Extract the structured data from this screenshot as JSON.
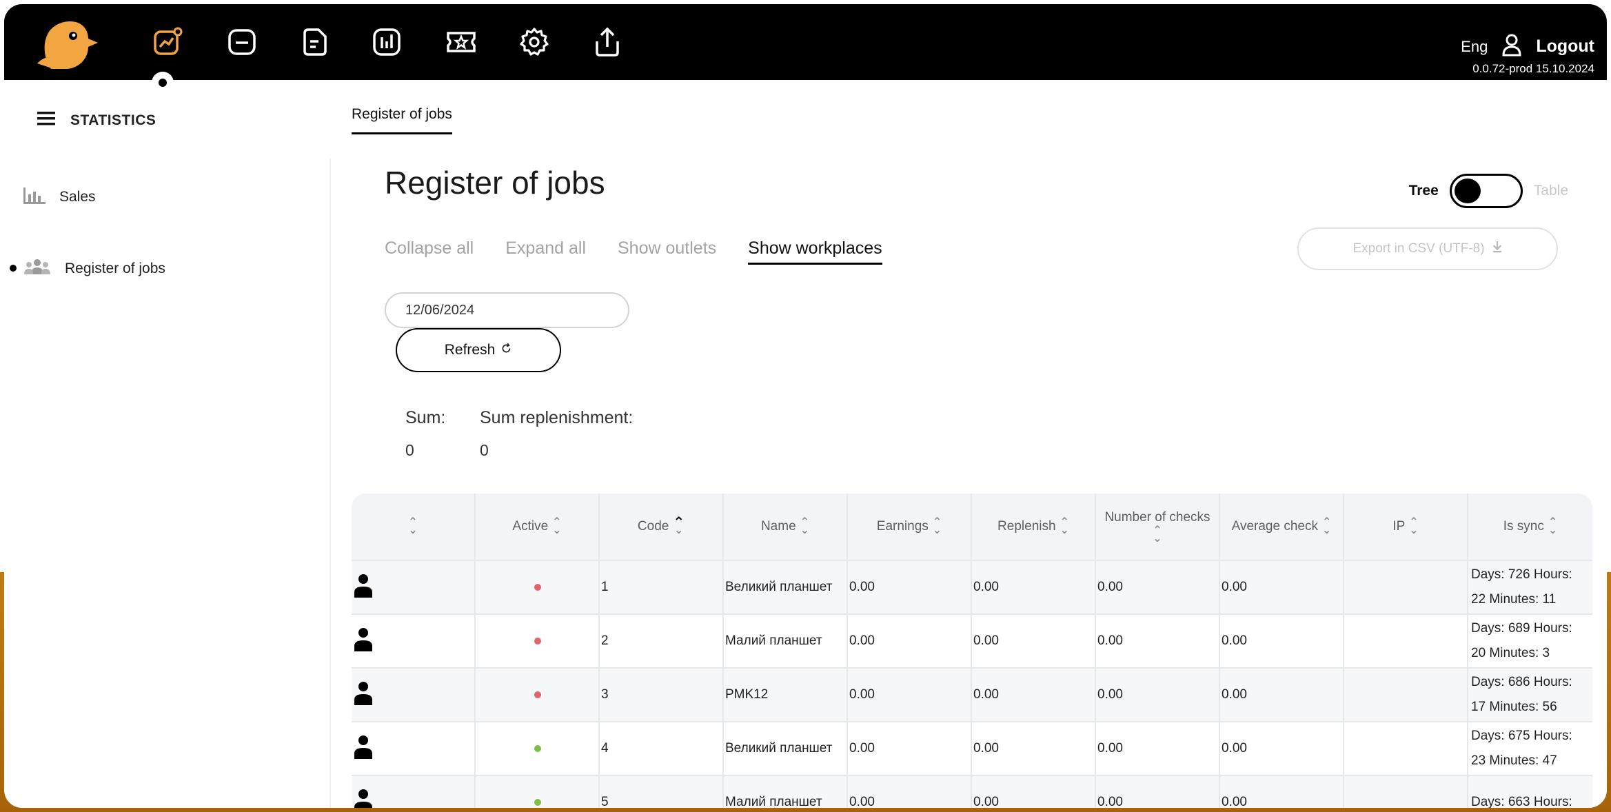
{
  "topbar": {
    "logo": "bird-logo",
    "nav_icons": [
      "statistics-icon",
      "folder-icon",
      "document-icon",
      "bar-chart-icon",
      "ticket-icon",
      "settings-icon",
      "upload-icon"
    ],
    "lang": "Eng",
    "logout": "Logout",
    "version": "0.0.72-prod 15.10.2024"
  },
  "sidebar": {
    "title": "STATISTICS",
    "items": [
      {
        "label": "Sales",
        "icon": "bar-chart-icon"
      },
      {
        "label": "Register of jobs",
        "icon": "people-icon",
        "active": true
      }
    ]
  },
  "breadcrumb": "Register of jobs",
  "page": {
    "title": "Register of jobs",
    "toggle": {
      "left": "Tree",
      "right": "Table",
      "state": "Tree"
    },
    "filters": [
      "Collapse all",
      "Expand all",
      "Show outlets",
      "Show workplaces"
    ],
    "export": "Export in CSV (UTF-8)",
    "date": "12/06/2024",
    "refresh": "Refresh",
    "sum_label": "Sum:",
    "sum_value": "0",
    "sum_repl_label": "Sum replenishment:",
    "sum_repl_value": "0"
  },
  "table": {
    "columns": [
      "",
      "Active",
      "Code",
      "Name",
      "Earnings",
      "Replenish",
      "Number of checks",
      "Average check",
      "IP",
      "Is sync"
    ],
    "rows": [
      {
        "active": "#e06666",
        "code": "1",
        "name": "Великий планшет",
        "earnings": "0.00",
        "replenish": "0.00",
        "checks": "0.00",
        "avg": "0.00",
        "ip": "",
        "sync1": "Days: 726 Hours:",
        "sync2": "22 Minutes: 11"
      },
      {
        "active": "#e06666",
        "code": "2",
        "name": "Малий планшет",
        "earnings": "0.00",
        "replenish": "0.00",
        "checks": "0.00",
        "avg": "0.00",
        "ip": "",
        "sync1": "Days: 689 Hours:",
        "sync2": "20 Minutes: 3"
      },
      {
        "active": "#e06666",
        "code": "3",
        "name": "PMK12",
        "earnings": "0.00",
        "replenish": "0.00",
        "checks": "0.00",
        "avg": "0.00",
        "ip": "",
        "sync1": "Days: 686 Hours:",
        "sync2": "17 Minutes: 56"
      },
      {
        "active": "#7cc04b",
        "code": "4",
        "name": "Великий планшет",
        "earnings": "0.00",
        "replenish": "0.00",
        "checks": "0.00",
        "avg": "0.00",
        "ip": "",
        "sync1": "Days: 675 Hours:",
        "sync2": "23 Minutes: 47"
      },
      {
        "active": "#7cc04b",
        "code": "5",
        "name": "Малий планшет",
        "earnings": "0.00",
        "replenish": "0.00",
        "checks": "0.00",
        "avg": "0.00",
        "ip": "",
        "sync1": "Days: 663 Hours:",
        "sync2": ""
      }
    ]
  }
}
